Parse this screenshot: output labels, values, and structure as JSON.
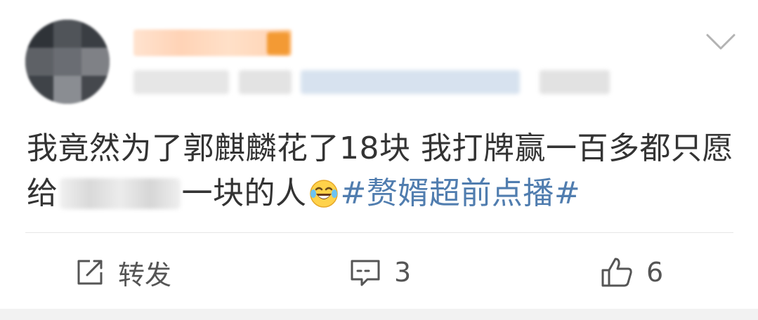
{
  "post": {
    "text_part1": "我竟然为了郭麒麟花了18块 我打牌赢一百多都只愿给",
    "text_part2": "一块的人",
    "hashtag": "#赘婿超前点播#"
  },
  "actions": {
    "repost_label": "转发",
    "comment_count": "3",
    "like_count": "6"
  },
  "icons": {
    "more": "chevron-down-icon",
    "repost": "repost-icon",
    "comment": "comment-icon",
    "like": "thumbs-up-icon",
    "emoji": "laughing-crying-emoji"
  },
  "colors": {
    "text": "#333333",
    "hashtag": "#507daf",
    "action_text": "#555555",
    "divider": "#e6e6e6"
  }
}
